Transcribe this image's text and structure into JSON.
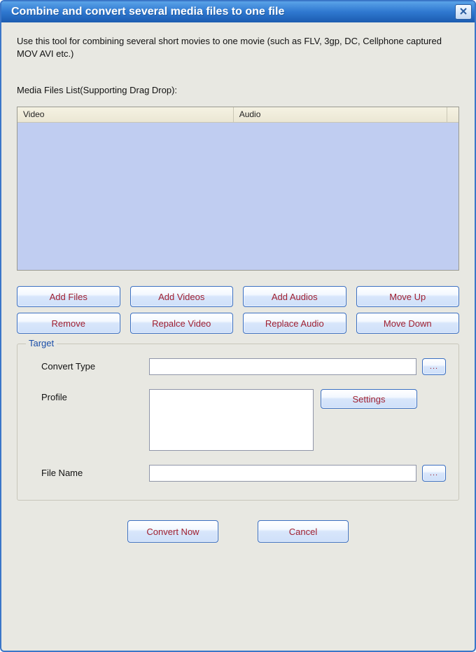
{
  "title": "Combine and convert several media files to one file",
  "intro": "Use this tool for combining several short movies to one movie (such as FLV, 3gp, DC, Cellphone captured MOV AVI etc.)",
  "media_list_label": "Media Files List(Supporting Drag  Drop):",
  "columns": {
    "video": "Video",
    "audio": "Audio"
  },
  "rows": [],
  "buttons": {
    "add_files": "Add Files",
    "add_videos": "Add Videos",
    "add_audios": "Add Audios",
    "move_up": "Move Up",
    "remove": "Remove",
    "replace_video": "Repalce Video",
    "replace_audio": "Replace Audio",
    "move_down": "Move Down",
    "browse": "...",
    "browse2": "...",
    "settings": "Settings",
    "convert_now": "Convert Now",
    "cancel": "Cancel"
  },
  "target": {
    "legend": "Target",
    "convert_type_label": "Convert Type",
    "convert_type_value": "",
    "profile_label": "Profile",
    "profile_value": "",
    "file_name_label": "File Name",
    "file_name_value": ""
  }
}
